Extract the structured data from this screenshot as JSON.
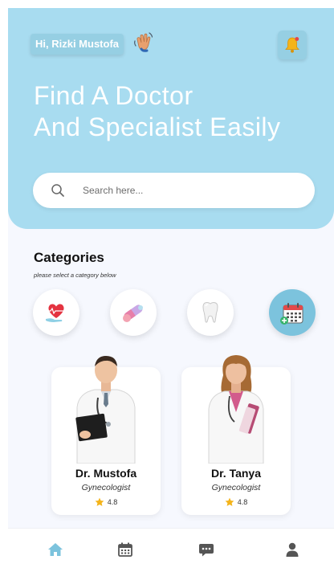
{
  "header": {
    "greeting": "Hi, Rizki Mustofa",
    "wave_icon": "waving-hand-icon",
    "notification_icon": "bell-icon",
    "title_line1": "Find A Doctor",
    "title_line2": "And Specialist Easily"
  },
  "search": {
    "placeholder": "Search here...",
    "icon": "search-icon"
  },
  "categories": {
    "title": "Categories",
    "subtitle": "please select a category below",
    "items": [
      {
        "icon": "heart-care-icon",
        "active": false
      },
      {
        "icon": "pills-icon",
        "active": false
      },
      {
        "icon": "tooth-icon",
        "active": false
      },
      {
        "icon": "calendar-icon",
        "active": true
      }
    ]
  },
  "doctors": [
    {
      "name": "Dr. Mustofa",
      "specialty": "Gynecologist",
      "rating": "4.8"
    },
    {
      "name": "Dr. Tanya",
      "specialty": "Gynecologist",
      "rating": "4.8"
    }
  ],
  "nav": {
    "items": [
      {
        "icon": "home-icon",
        "active": true
      },
      {
        "icon": "calendar-icon",
        "active": false
      },
      {
        "icon": "chat-icon",
        "active": false
      },
      {
        "icon": "profile-icon",
        "active": false
      }
    ]
  },
  "colors": {
    "accent": "#a8dcf0",
    "accent_dark": "#7cc3dd",
    "active_nav": "#7cc3dd",
    "inactive_nav": "#555555"
  }
}
